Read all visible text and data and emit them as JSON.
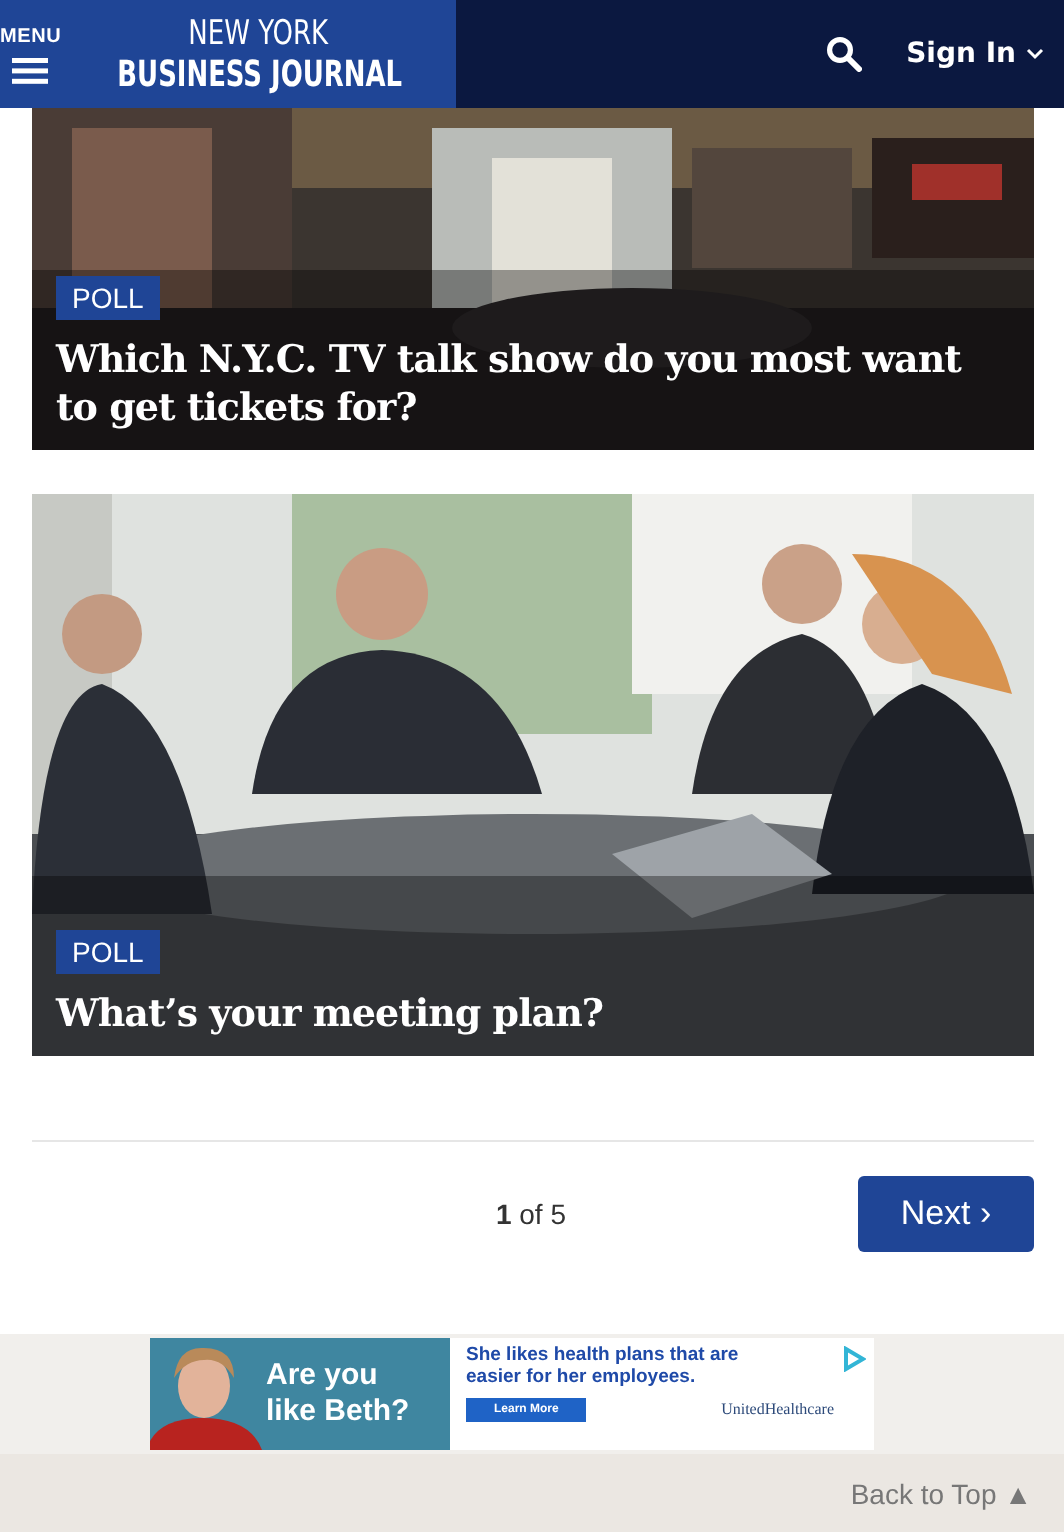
{
  "header": {
    "menu_label": "MENU",
    "logo_top": "NEW YORK",
    "logo_bottom": "BUSINESS JOURNAL",
    "sign_in": "Sign In"
  },
  "cards": [
    {
      "badge": "POLL",
      "title": "Which N.Y.C. TV talk show do you most want to get tickets for?"
    },
    {
      "badge": "POLL",
      "title": "What’s your meeting plan?"
    }
  ],
  "pagination": {
    "text": "**1** of 5",
    "next": "Next ›"
  },
  "ad": {
    "headline": "Are you like Beth?",
    "body": "She likes health plans that are easier for her employees.",
    "button": "Learn More",
    "brand": "UnitedHealthcare"
  },
  "footer": {
    "back_to_top": "Back to Top ▲"
  }
}
